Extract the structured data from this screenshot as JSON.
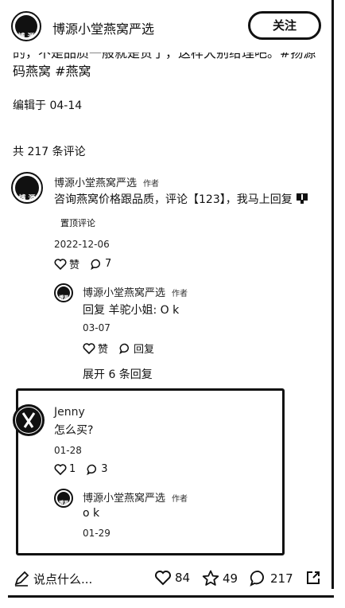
{
  "header": {
    "author_name": "博源小堂燕窝严选",
    "follow_label": "关注"
  },
  "post": {
    "cut_line": "的，不是品质一般就是贵了，这样大别给理吧。#扬源",
    "tags_line": "码燕窝 #燕窝",
    "edited": "编辑于 04-14"
  },
  "comments_count": "共 217 条评论",
  "comment1": {
    "name": "博源小堂燕窝严选",
    "author_tag": "作者",
    "text": "咨询燕窝价格跟品质，评论【123】，我马上回复",
    "pinned_label": "置顶评论",
    "date": "2022-12-06",
    "like_label": "赞",
    "reply_count": "7"
  },
  "reply1": {
    "name": "博源小堂燕窝严选",
    "author_tag": "作者",
    "text": "回复 羊驼小姐: O k",
    "date": "03-07",
    "like_label": "赞",
    "reply_label": "回复"
  },
  "expand_label": "展开 6 条回复",
  "comment2": {
    "name": "Jenny",
    "text": "怎么买?",
    "date": "01-28",
    "like_count": "1",
    "reply_count": "3"
  },
  "reply2": {
    "name": "博源小堂燕窝严选",
    "author_tag": "作者",
    "text": "o k",
    "date": "01-29"
  },
  "bottom_bar": {
    "input_placeholder": "说点什么...",
    "likes": "84",
    "stars": "49",
    "comments": "217"
  }
}
